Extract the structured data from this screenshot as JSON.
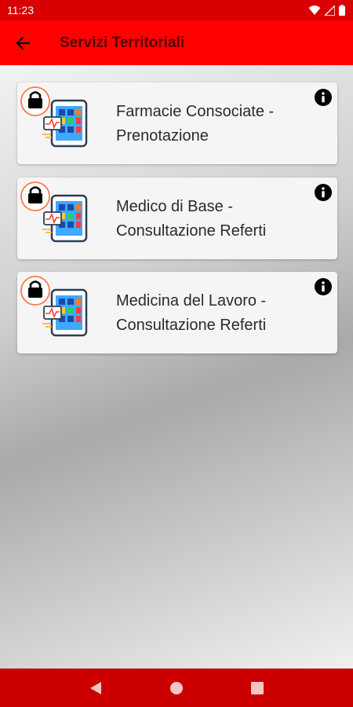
{
  "status_bar": {
    "time": "11:23"
  },
  "app_bar": {
    "title": "Servizi Territoriali",
    "back_icon": "arrow-left-icon"
  },
  "services": [
    {
      "line1": "Farmacie Consociate -",
      "line2": "Prenotazione",
      "locked": true
    },
    {
      "line1": "Medico di Base -",
      "line2": "Consultazione Referti",
      "locked": true
    },
    {
      "line1": "Medicina del Lavoro -",
      "line2": "Consultazione Referti",
      "locked": true
    }
  ],
  "colors": {
    "app_bar": "#ff0000",
    "status_bar": "#d80000",
    "nav_bar": "#cc0000",
    "title_text": "#5a0000"
  },
  "nav_bar": {
    "icons": [
      "back-triangle-icon",
      "home-circle-icon",
      "recents-square-icon"
    ]
  }
}
